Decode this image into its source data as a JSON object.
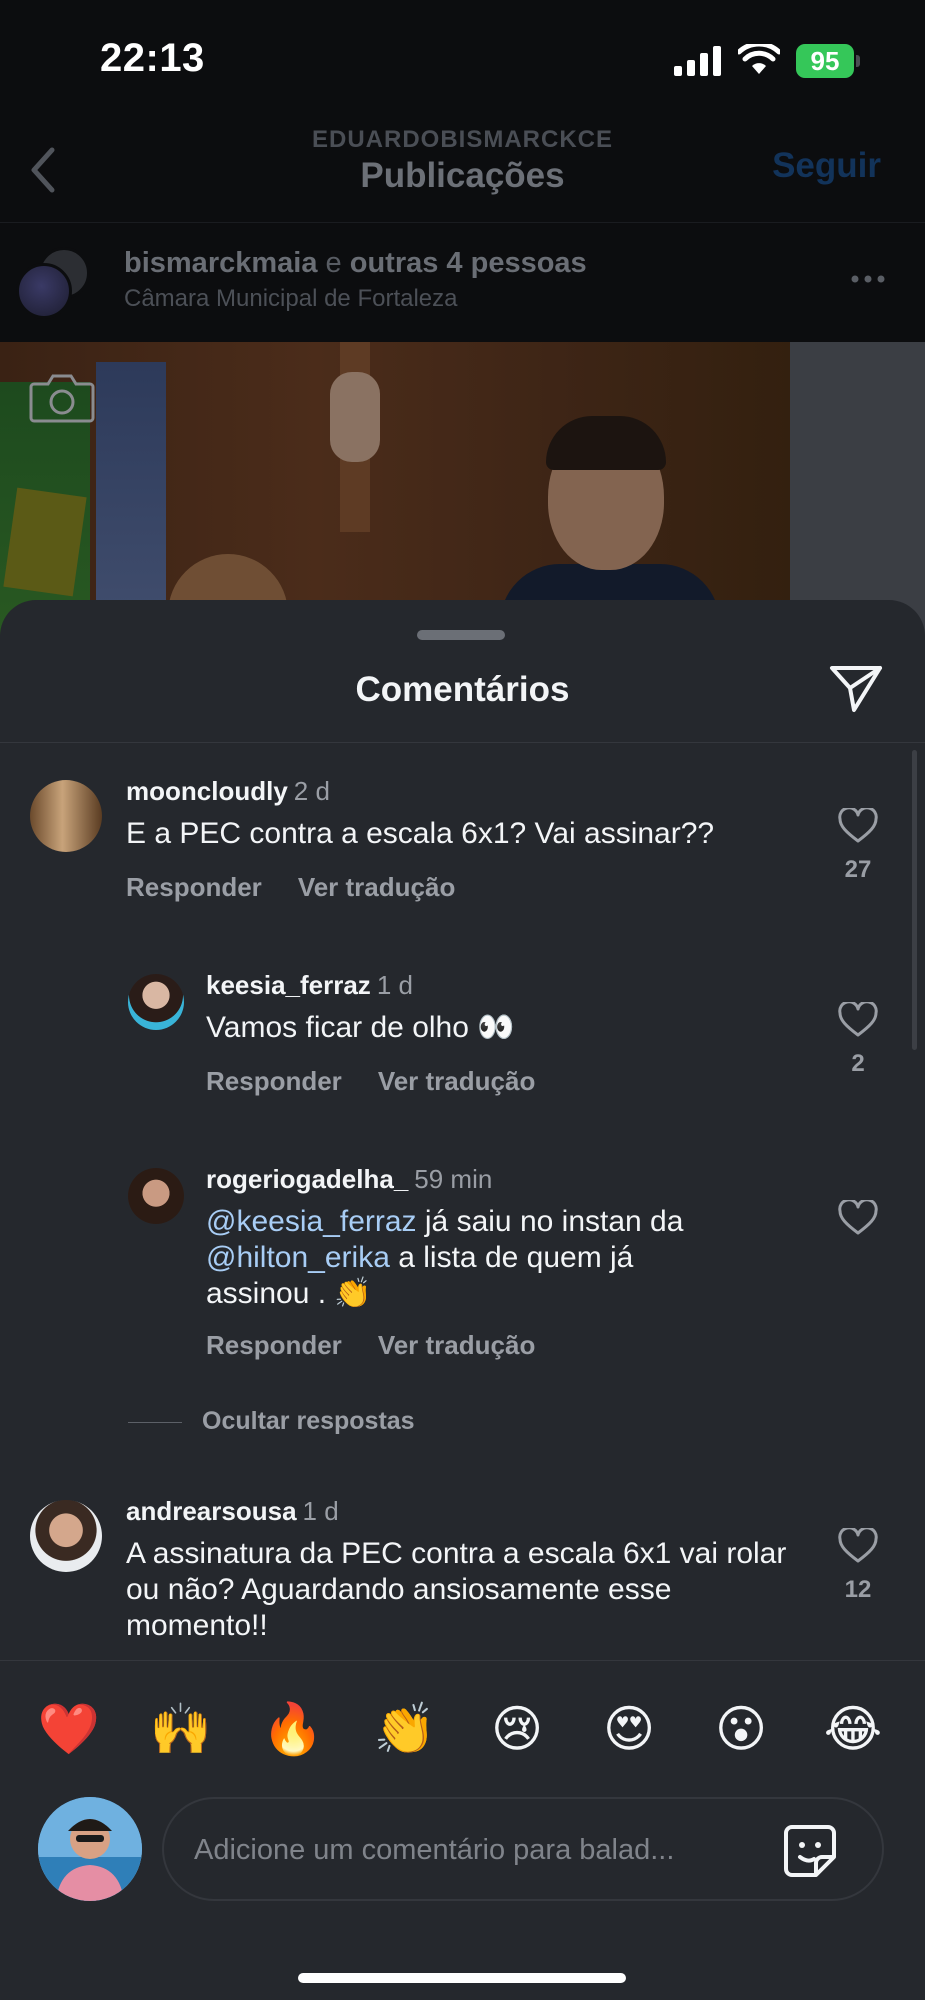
{
  "status_bar": {
    "time": "22:13",
    "battery": "95"
  },
  "header": {
    "username": "EDUARDOBISMARCKCE",
    "title": "Publicações",
    "follow_label": "Seguir"
  },
  "post": {
    "author_primary": "bismarckmaia",
    "author_connector": "e",
    "author_others": "outras 4 pessoas",
    "location": "Câmara Municipal de Fortaleza"
  },
  "sheet": {
    "title": "Comentários"
  },
  "comments": [
    {
      "username": "mooncloudly",
      "time": "2 d",
      "text": "E a PEC contra a escala 6x1? Vai assinar??",
      "reply_label": "Responder",
      "translate_label": "Ver tradução",
      "likes": "27"
    },
    {
      "username": "keesia_ferraz",
      "time": "1 d",
      "text": "Vamos ficar de olho 👀",
      "reply_label": "Responder",
      "translate_label": "Ver tradução",
      "likes": "2"
    },
    {
      "username": "rogeriogadelha_",
      "time": "59 min",
      "mention1": "@keesia_ferraz",
      "text_part1": "já saiu no instan da",
      "mention2": "@hilton_erika",
      "text_part2": "a lista de quem já",
      "text_part3": "assinou . 👏",
      "reply_label": "Responder",
      "translate_label": "Ver tradução",
      "likes": ""
    },
    {
      "username": "andrearsousa",
      "time": "1 d",
      "text": "A assinatura da PEC contra a escala 6x1 vai rolar ou não? Aguardando ansiosamente esse momento!!",
      "likes": "12"
    }
  ],
  "hide_replies_label": "Ocultar respostas",
  "emoji_bar": [
    "❤️",
    "🙌",
    "🔥",
    "👏",
    "😢",
    "😍",
    "😮",
    "😂"
  ],
  "composer": {
    "placeholder": "Adicione um comentário para balad..."
  },
  "icons": {
    "back": "chevron-left-icon",
    "more": "more-horizontal-icon",
    "camera": "camera-icon",
    "share": "paper-plane-icon",
    "like": "heart-outline-icon",
    "sticker": "sticker-icon"
  },
  "colors": {
    "sheet_bg": "#25282d",
    "mention": "#a8cdf5",
    "muted_text": "#9a9ea5",
    "battery": "#35c759"
  }
}
